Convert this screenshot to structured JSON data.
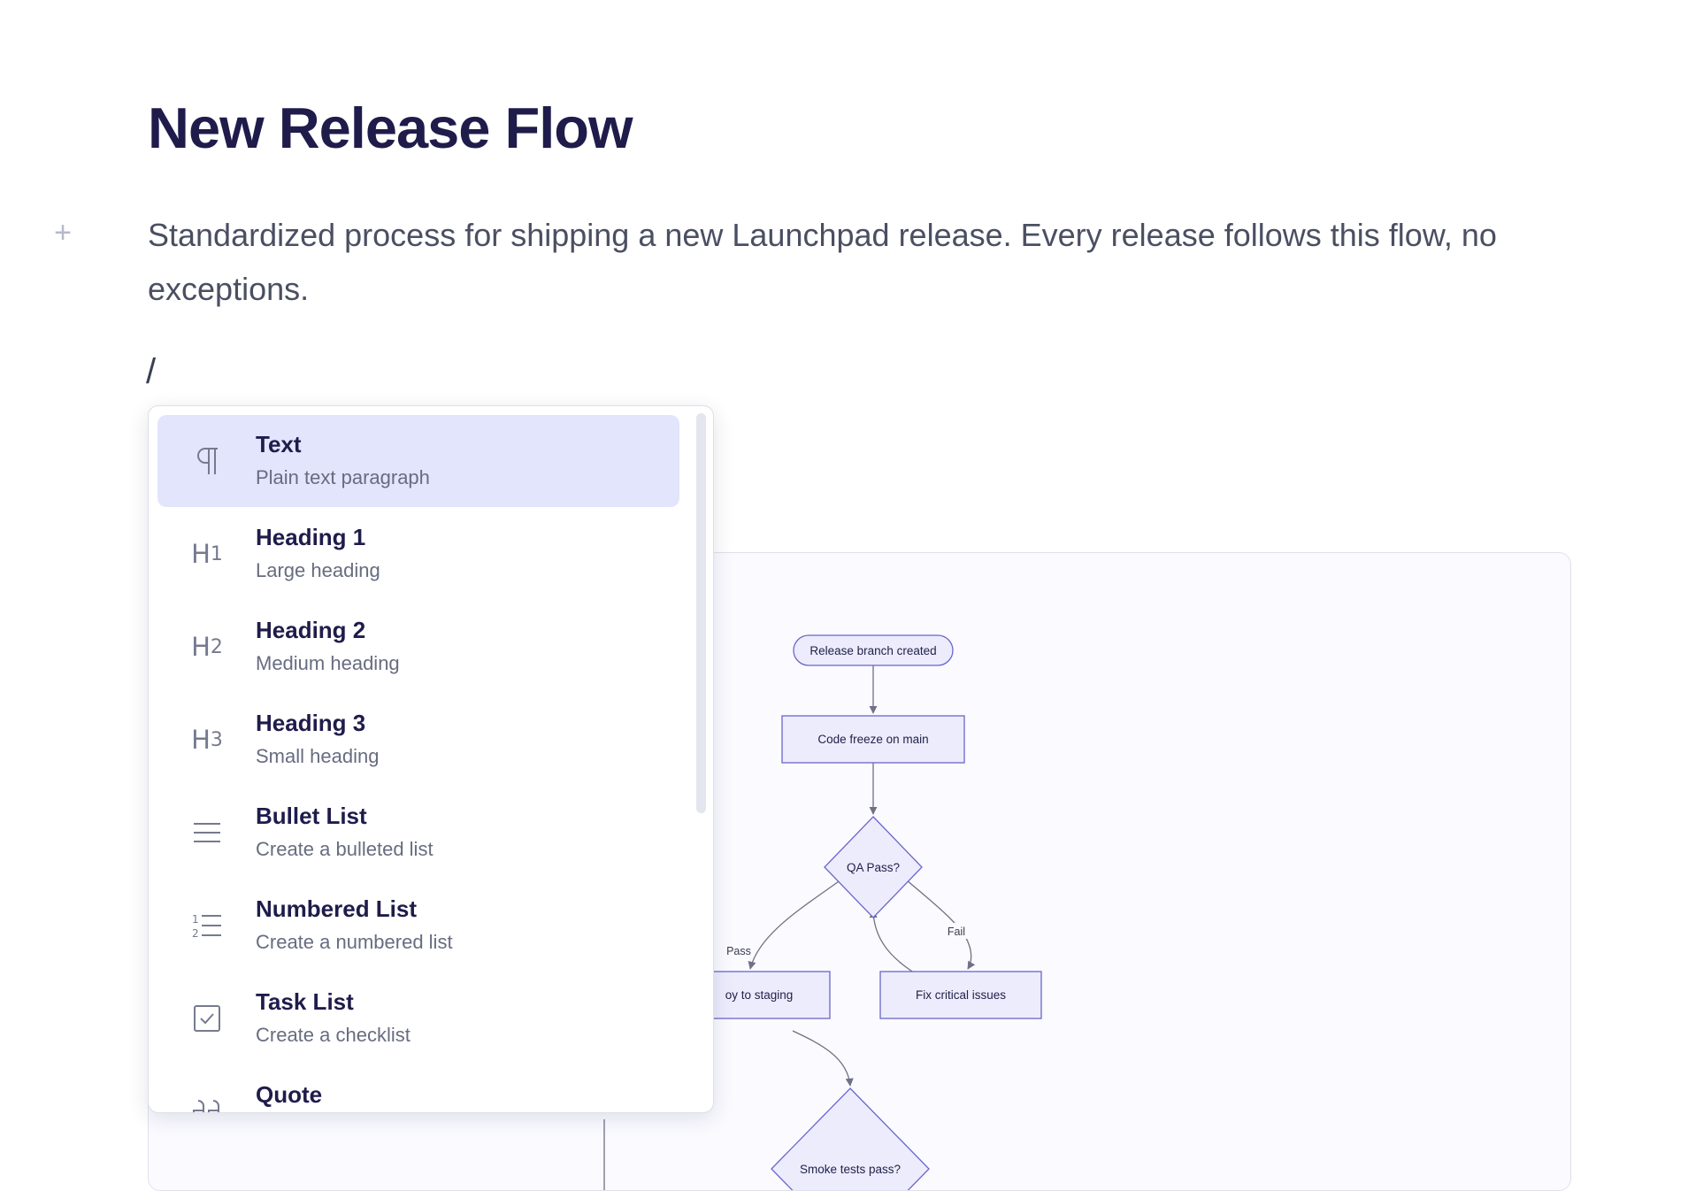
{
  "document": {
    "title": "New Release Flow",
    "description": "Standardized process for shipping a new Launchpad release. Every release follows this flow, no exceptions.",
    "slash_input": "/",
    "add_block_icon": "plus-icon"
  },
  "command_menu": {
    "selected_index": 0,
    "items": [
      {
        "label": "Text",
        "description": "Plain text paragraph",
        "icon": "paragraph-icon"
      },
      {
        "label": "Heading 1",
        "description": "Large heading",
        "icon": "heading-1-icon"
      },
      {
        "label": "Heading 2",
        "description": "Medium heading",
        "icon": "heading-2-icon"
      },
      {
        "label": "Heading 3",
        "description": "Small heading",
        "icon": "heading-3-icon"
      },
      {
        "label": "Bullet List",
        "description": "Create a bulleted list",
        "icon": "bullet-list-icon"
      },
      {
        "label": "Numbered List",
        "description": "Create a numbered list",
        "icon": "numbered-list-icon"
      },
      {
        "label": "Task List",
        "description": "Create a checklist",
        "icon": "task-list-icon"
      },
      {
        "label": "Quote",
        "description": "",
        "icon": "quote-icon"
      }
    ]
  },
  "flowchart": {
    "nodes": {
      "start": "Release branch created",
      "freeze": "Code freeze on main",
      "qa": "QA Pass?",
      "staging": "oy to staging",
      "fix": "Fix critical issues",
      "smoke": "Smoke tests pass?"
    },
    "edges": {
      "pass": "Pass",
      "fail": "Fail"
    },
    "colors": {
      "node_fill": "#ececfd",
      "node_stroke": "#6a66c9",
      "edge": "#6f7184"
    }
  },
  "colors": {
    "title": "#1f1c4b",
    "body_text": "#4a4f62",
    "menu_selected": "#e2e5fc"
  }
}
